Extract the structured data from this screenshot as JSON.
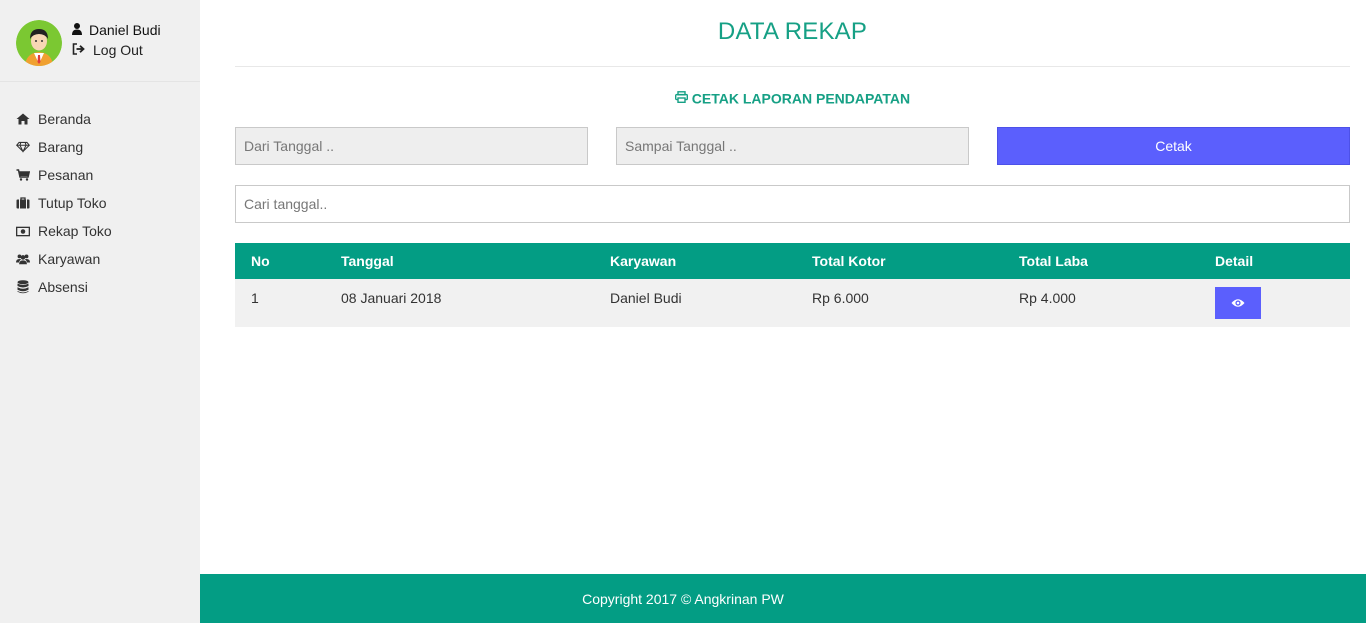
{
  "user": {
    "name": "Daniel Budi",
    "logout_label": "Log Out"
  },
  "nav": {
    "items": [
      {
        "label": "Beranda",
        "icon": "home-icon"
      },
      {
        "label": "Barang",
        "icon": "diamond-icon"
      },
      {
        "label": "Pesanan",
        "icon": "cart-icon"
      },
      {
        "label": "Tutup Toko",
        "icon": "briefcase-icon"
      },
      {
        "label": "Rekap Toko",
        "icon": "money-icon"
      },
      {
        "label": "Karyawan",
        "icon": "users-icon"
      },
      {
        "label": "Absensi",
        "icon": "database-icon"
      }
    ]
  },
  "page": {
    "title": "DATA REKAP",
    "print_link": "CETAK LAPORAN PENDAPATAN",
    "from_placeholder": "Dari Tanggal ..",
    "to_placeholder": "Sampai Tanggal ..",
    "print_button": "Cetak",
    "search_placeholder": "Cari tanggal.."
  },
  "table": {
    "headers": [
      "No",
      "Tanggal",
      "Karyawan",
      "Total Kotor",
      "Total Laba",
      "Detail"
    ],
    "rows": [
      {
        "no": "1",
        "tanggal": "08 Januari 2018",
        "karyawan": "Daniel Budi",
        "total_kotor": "Rp 6.000",
        "total_laba": "Rp 4.000"
      }
    ]
  },
  "footer": {
    "text": "Copyright 2017 © Angkrinan PW"
  },
  "colors": {
    "accent": "#16a085",
    "header_bg": "#039d84",
    "button": "#5b5ffd",
    "sidebar_bg": "#f0f0f0"
  }
}
